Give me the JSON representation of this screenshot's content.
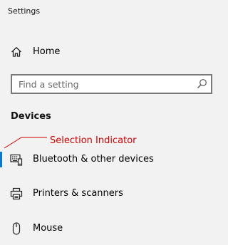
{
  "window": {
    "title": "Settings"
  },
  "nav": {
    "home_label": "Home",
    "search": {
      "placeholder": "Find a setting",
      "value": ""
    },
    "section_heading": "Devices",
    "items": [
      {
        "label": "Bluetooth & other devices",
        "icon": "bluetooth-devices-icon",
        "selected": true
      },
      {
        "label": "Printers & scanners",
        "icon": "printer-icon",
        "selected": false
      },
      {
        "label": "Mouse",
        "icon": "mouse-icon",
        "selected": false
      }
    ]
  },
  "annotation": {
    "text": "Selection Indicator",
    "color": "#d00000"
  },
  "colors": {
    "accent": "#0078d7",
    "background": "#f2f2f2"
  }
}
